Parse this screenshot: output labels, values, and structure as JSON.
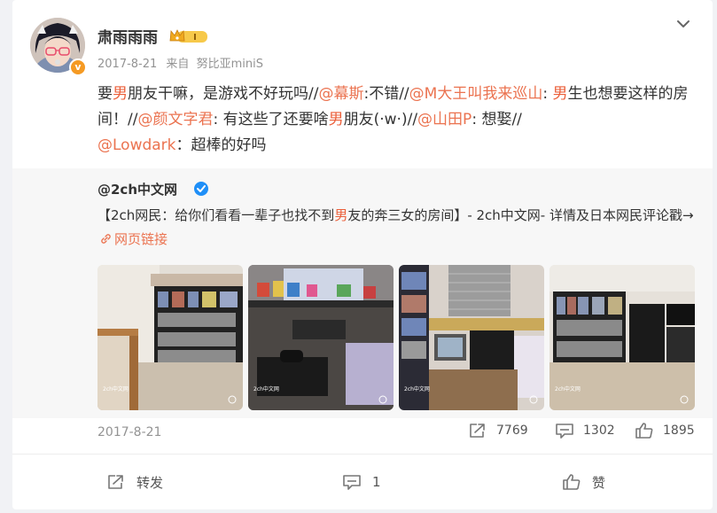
{
  "post": {
    "author": "肃雨雨雨",
    "vip_level": "I",
    "date": "2017-8-21",
    "source_prefix": "来自",
    "source_device": "努比亚miniS",
    "text": {
      "s1": "要",
      "s2": "男",
      "s3": "朋友干嘛，是游戏不好玩吗//",
      "m1": "@幕斯",
      "s4": ":不错//",
      "m2": "@M大王叫我来巡山",
      "s5": ": ",
      "s6": "男",
      "s7": "生也想要这样的房间！//",
      "m3": "@颜文字君",
      "s8": ": 有这些了还要啥",
      "s9": "男",
      "s10": "朋友(·w·)//",
      "m4": "@山田P",
      "s11": ": 想娶//",
      "m5": "@Lowdark",
      "s12": "：超棒的好吗"
    }
  },
  "repost": {
    "author": "@2ch中文网",
    "text": {
      "r1": "【2ch网民：给你们看看一辈子也找不到",
      "r2": "男",
      "r3": "友的奔三女的房间】- 2ch中文网- 详情及日本网民评论戳→",
      "link": "网页链接"
    },
    "images": [
      {
        "name": "room-photo-1"
      },
      {
        "name": "room-photo-2"
      },
      {
        "name": "room-photo-3"
      },
      {
        "name": "room-photo-4"
      }
    ],
    "watermark": "2ch中文网",
    "date": "2017-8-21",
    "stats": {
      "reposts": "7769",
      "comments": "1302",
      "likes": "1895"
    }
  },
  "actions": {
    "repost": "转发",
    "comment": "1",
    "like": "赞"
  },
  "colors": {
    "accent": "#eb7350",
    "highlight": "#eb5f3a",
    "verify_blue": "#1f8ff7",
    "badge_orange": "#f59a23"
  }
}
